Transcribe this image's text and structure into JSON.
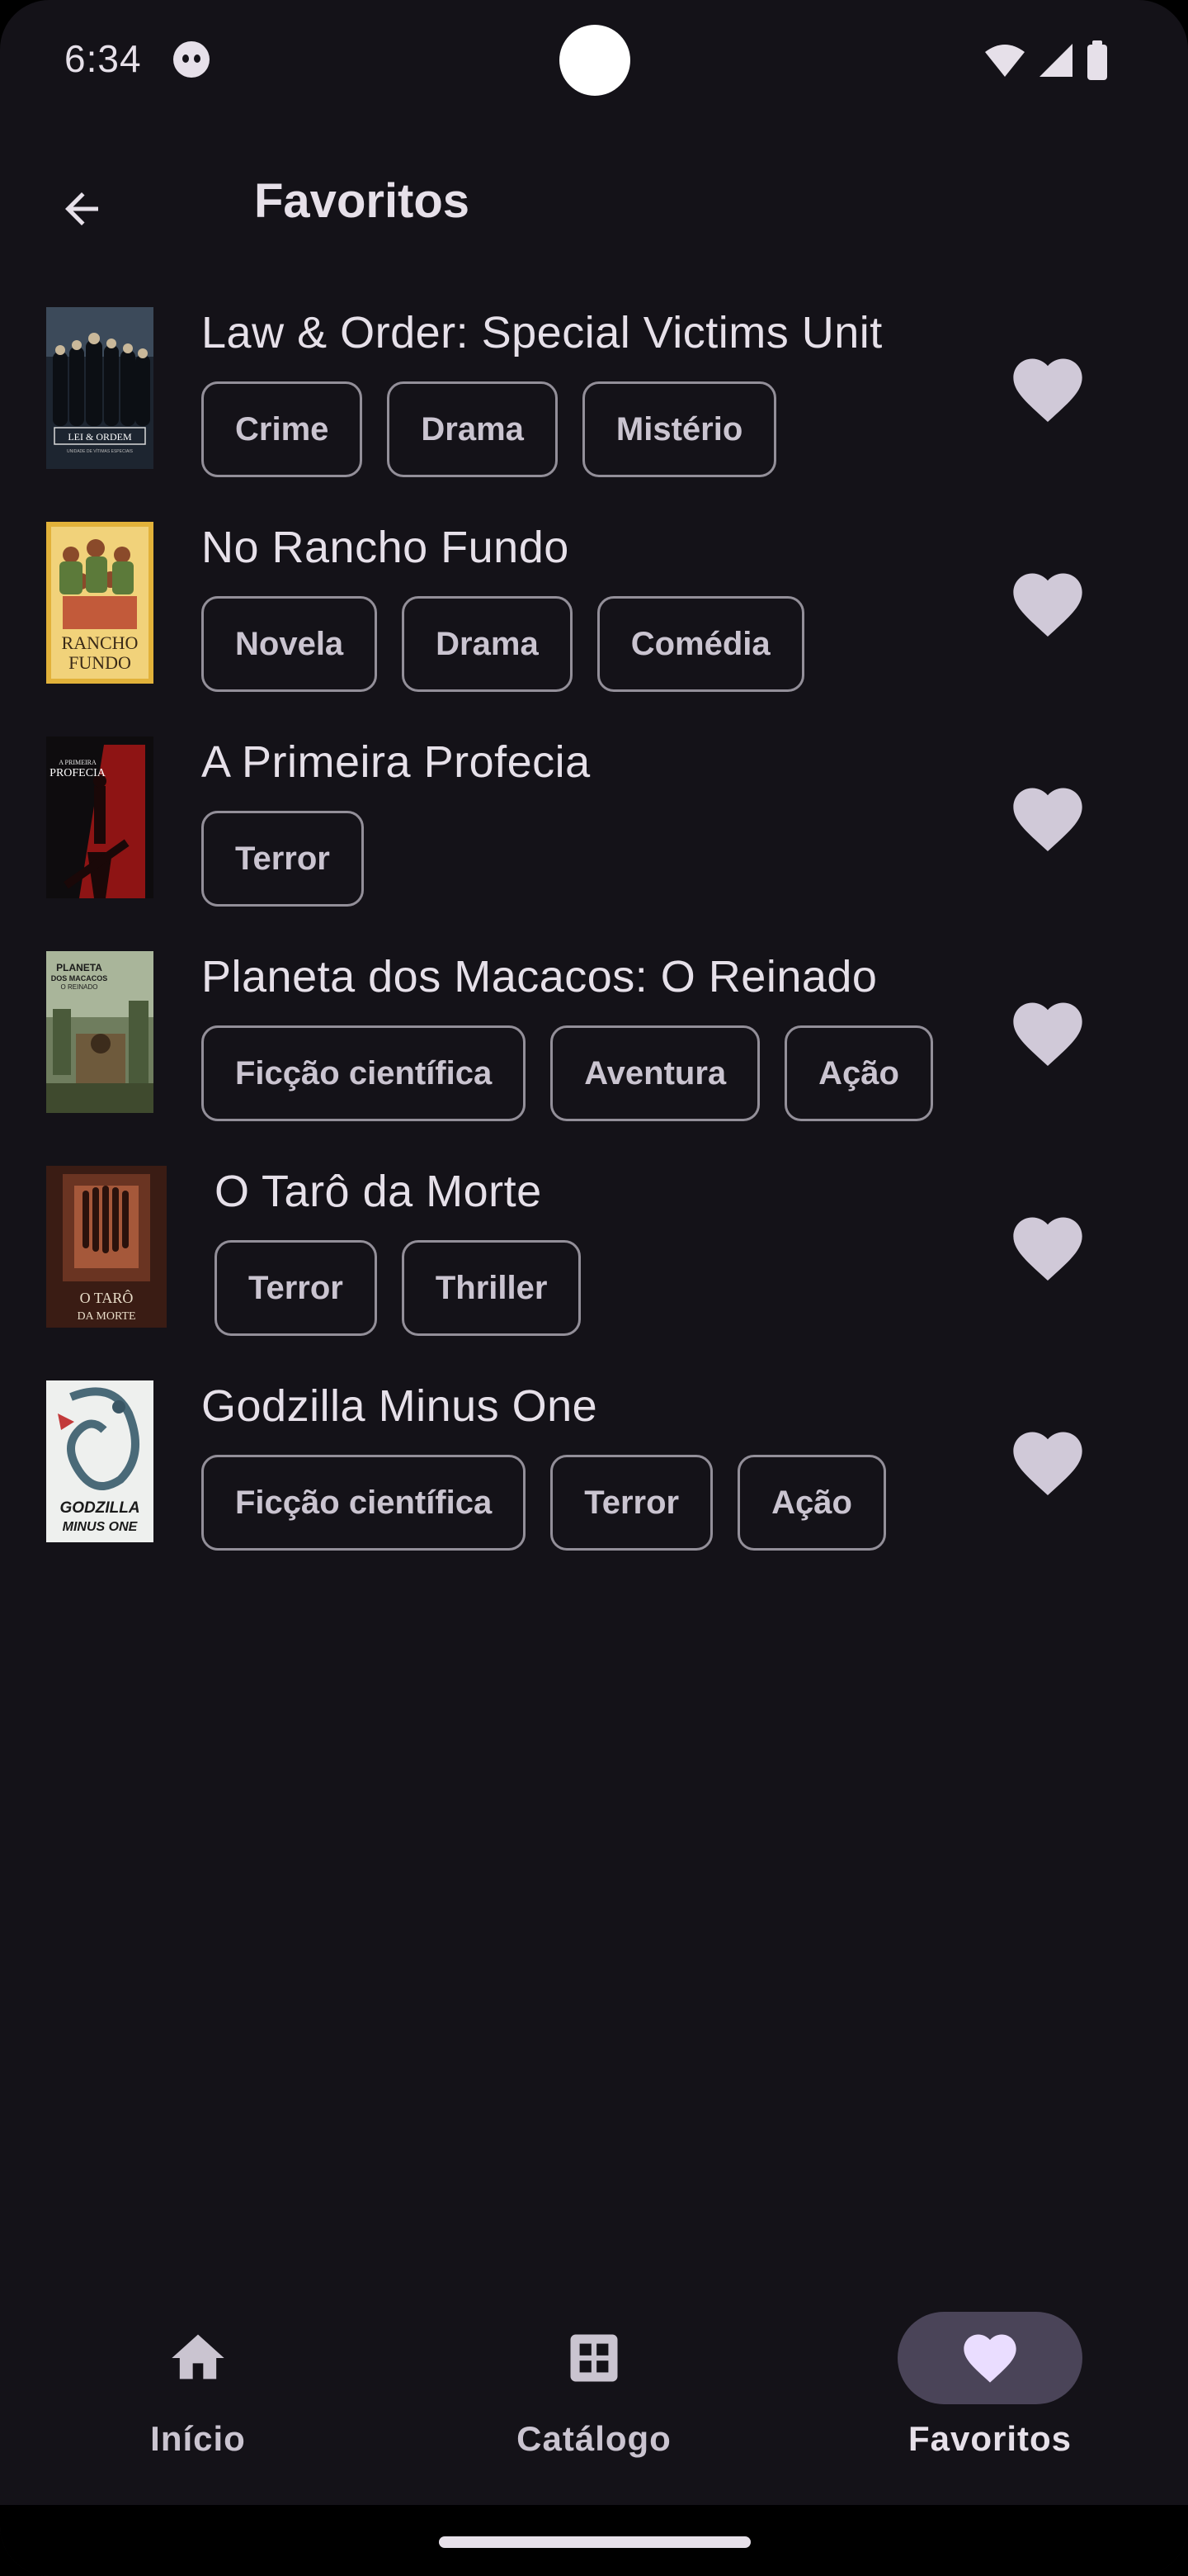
{
  "status_bar": {
    "time": "6:34"
  },
  "header": {
    "title": "Favoritos",
    "back_icon": "arrow-back-icon"
  },
  "favorites": [
    {
      "title": "Law & Order: Special Victims Unit",
      "genres": [
        "Crime",
        "Drama",
        "Mistério"
      ],
      "poster_lettering": [
        "LEI & ORDEM",
        "UNIDADE DE VÍTIMAS ESPECIAIS"
      ]
    },
    {
      "title": "No Rancho Fundo",
      "genres": [
        "Novela",
        "Drama",
        "Comédia"
      ],
      "poster_lettering": [
        "RANCHO",
        "FUNDO"
      ]
    },
    {
      "title": "A Primeira Profecia",
      "genres": [
        "Terror"
      ],
      "poster_lettering": [
        "A PRIMEIRA",
        "PROFECIA"
      ]
    },
    {
      "title": "Planeta dos Macacos: O Reinado",
      "genres": [
        "Ficção científica",
        "Aventura",
        "Ação"
      ],
      "poster_lettering": [
        "PLANETA",
        "DOS MACACOS",
        "O REINADO"
      ]
    },
    {
      "title": "O Tarô da Morte",
      "genres": [
        "Terror",
        "Thriller"
      ],
      "poster_lettering": [
        "O TARÔ",
        "DA MORTE"
      ]
    },
    {
      "title": "Godzilla Minus One",
      "genres": [
        "Ficção científica",
        "Terror",
        "Ação"
      ],
      "poster_lettering": [
        "GODZILLA",
        "MINUS ONE"
      ]
    }
  ],
  "bottom_nav": {
    "items": [
      {
        "label": "Início",
        "icon": "home-icon",
        "active": false
      },
      {
        "label": "Catálogo",
        "icon": "grid-icon",
        "active": false
      },
      {
        "label": "Favoritos",
        "icon": "heart-icon",
        "active": true
      }
    ]
  },
  "colors": {
    "background": "#141218",
    "on_surface": "#e6e0e9",
    "chip_outline": "#938f99",
    "nav_indicator": "#4a4458",
    "heart": "#d0c9d8"
  }
}
